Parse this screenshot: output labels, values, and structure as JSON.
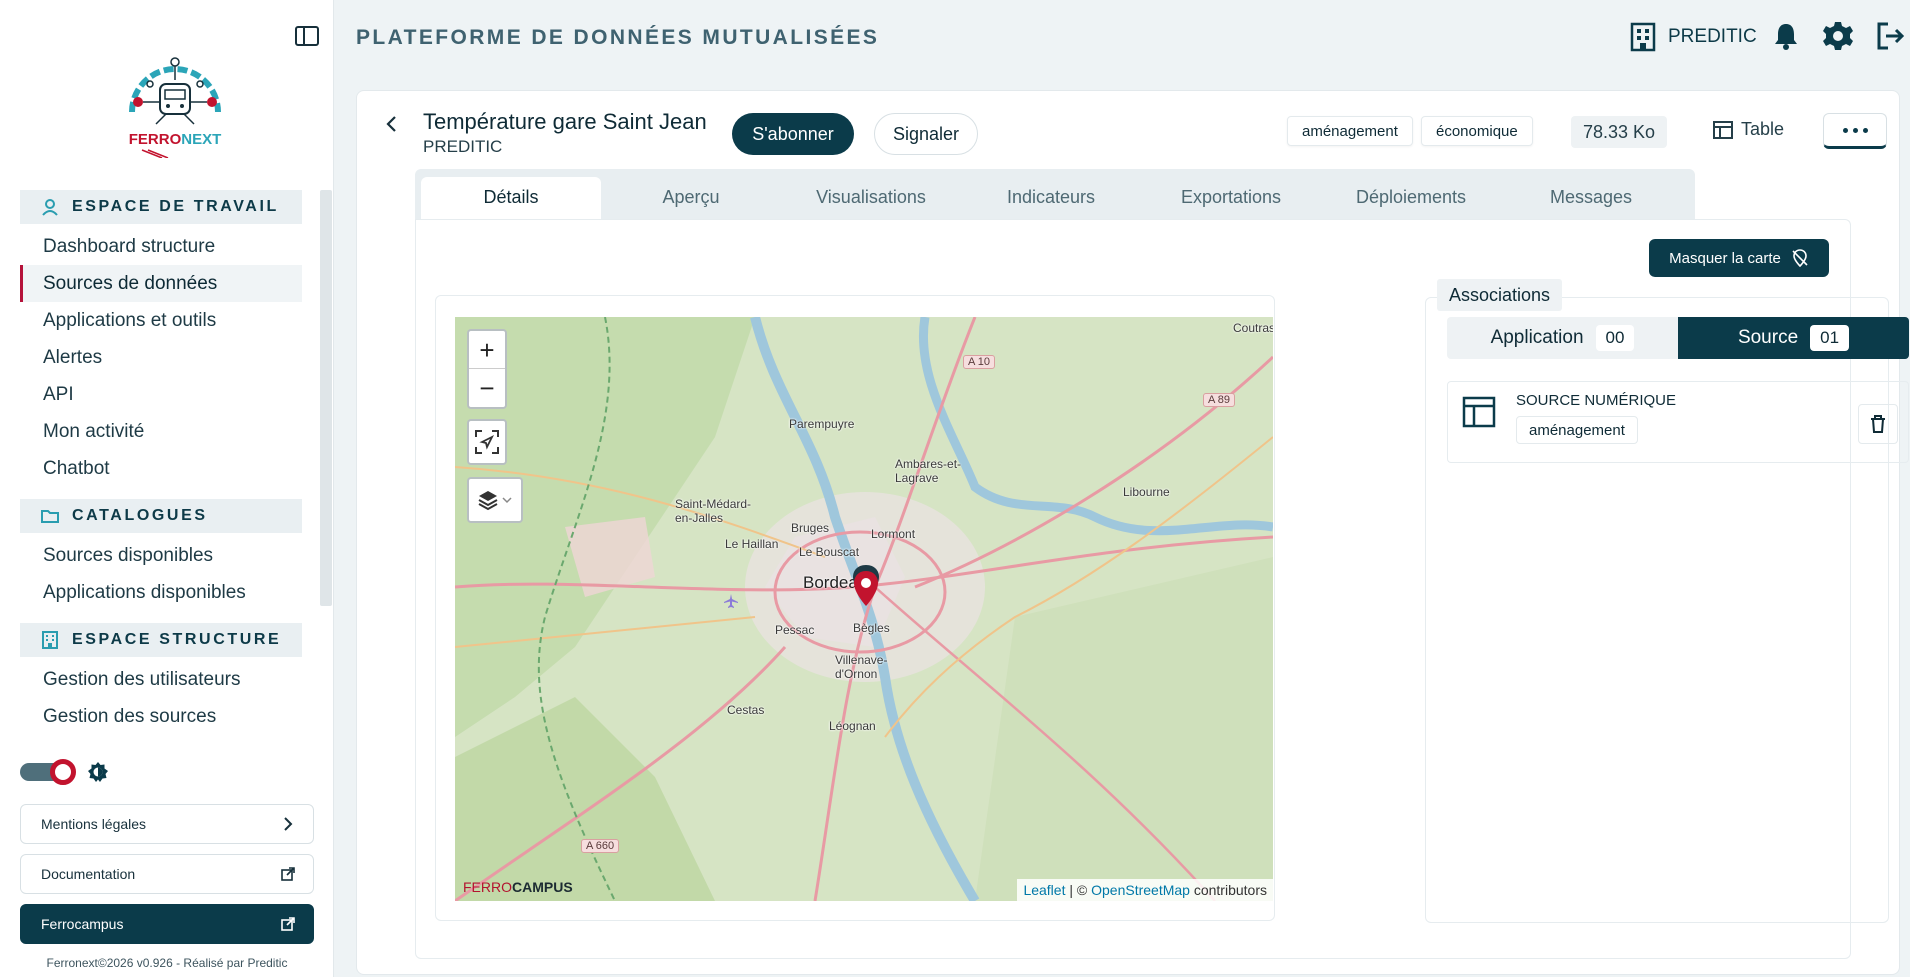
{
  "sidebar": {
    "logo_text": "FERRONEXT",
    "sections": [
      {
        "title": "ESPACE DE TRAVAIL",
        "items": [
          "Dashboard structure",
          "Sources de données",
          "Applications et outils",
          "Alertes",
          "API",
          "Mon activité",
          "Chatbot"
        ]
      },
      {
        "title": "CATALOGUES",
        "items": [
          "Sources disponibles",
          "Applications disponibles"
        ]
      },
      {
        "title": "ESPACE STRUCTURE",
        "items": [
          "Gestion des utilisateurs",
          "Gestion des sources"
        ]
      }
    ],
    "active_item": "Sources de données",
    "links": {
      "mentions": "Mentions légales",
      "documentation": "Documentation",
      "ferrocampus": "Ferrocampus"
    },
    "footer": "Ferronext©2026 v0.926 - Réalisé par Preditic"
  },
  "header": {
    "title": "PLATEFORME DE DONNÉES MUTUALISÉES",
    "organization": "PREDITIC"
  },
  "dataset": {
    "title": "Température gare Saint Jean",
    "owner": "PREDITIC",
    "subscribe_label": "S'abonner",
    "report_label": "Signaler",
    "tags": [
      "aménagement",
      "économique"
    ],
    "size": "78.33 Ko",
    "view_label": "Table"
  },
  "tabs": [
    "Détails",
    "Aperçu",
    "Visualisations",
    "Indicateurs",
    "Exportations",
    "Déploiements",
    "Messages"
  ],
  "active_tab": "Détails",
  "map": {
    "hide_label": "Masquer la carte",
    "zoom_in": "+",
    "zoom_out": "−",
    "attribution_leaflet": "Leaflet",
    "attribution_sep": " | © ",
    "attribution_osm": "OpenStreetMap",
    "attribution_tail": " contributors",
    "logo_main": "FERRO",
    "logo_bold": "CAMPUS",
    "places": [
      "Coutras",
      "Parempuyre",
      "Ambares-et-Lagrave",
      "Libourne",
      "Saint-Médard-en-Jalles",
      "Le Haillan",
      "Bruges",
      "Lormont",
      "Le Bouscat",
      "Bordeaux",
      "Pessac",
      "Bègles",
      "Villenave-d'Ornon",
      "Cestas",
      "Léognan"
    ],
    "roads": [
      "A 10",
      "A 89",
      "A 660"
    ]
  },
  "associations": {
    "title": "Associations",
    "application_label": "Application",
    "application_count": "00",
    "source_label": "Source",
    "source_count": "01",
    "source_item": {
      "name": "SOURCE NUMÉRIQUE",
      "tag": "aménagement"
    }
  },
  "colors": {
    "primary": "#0b3b4a",
    "accent": "#c2132e",
    "background": "#eef3f5"
  }
}
